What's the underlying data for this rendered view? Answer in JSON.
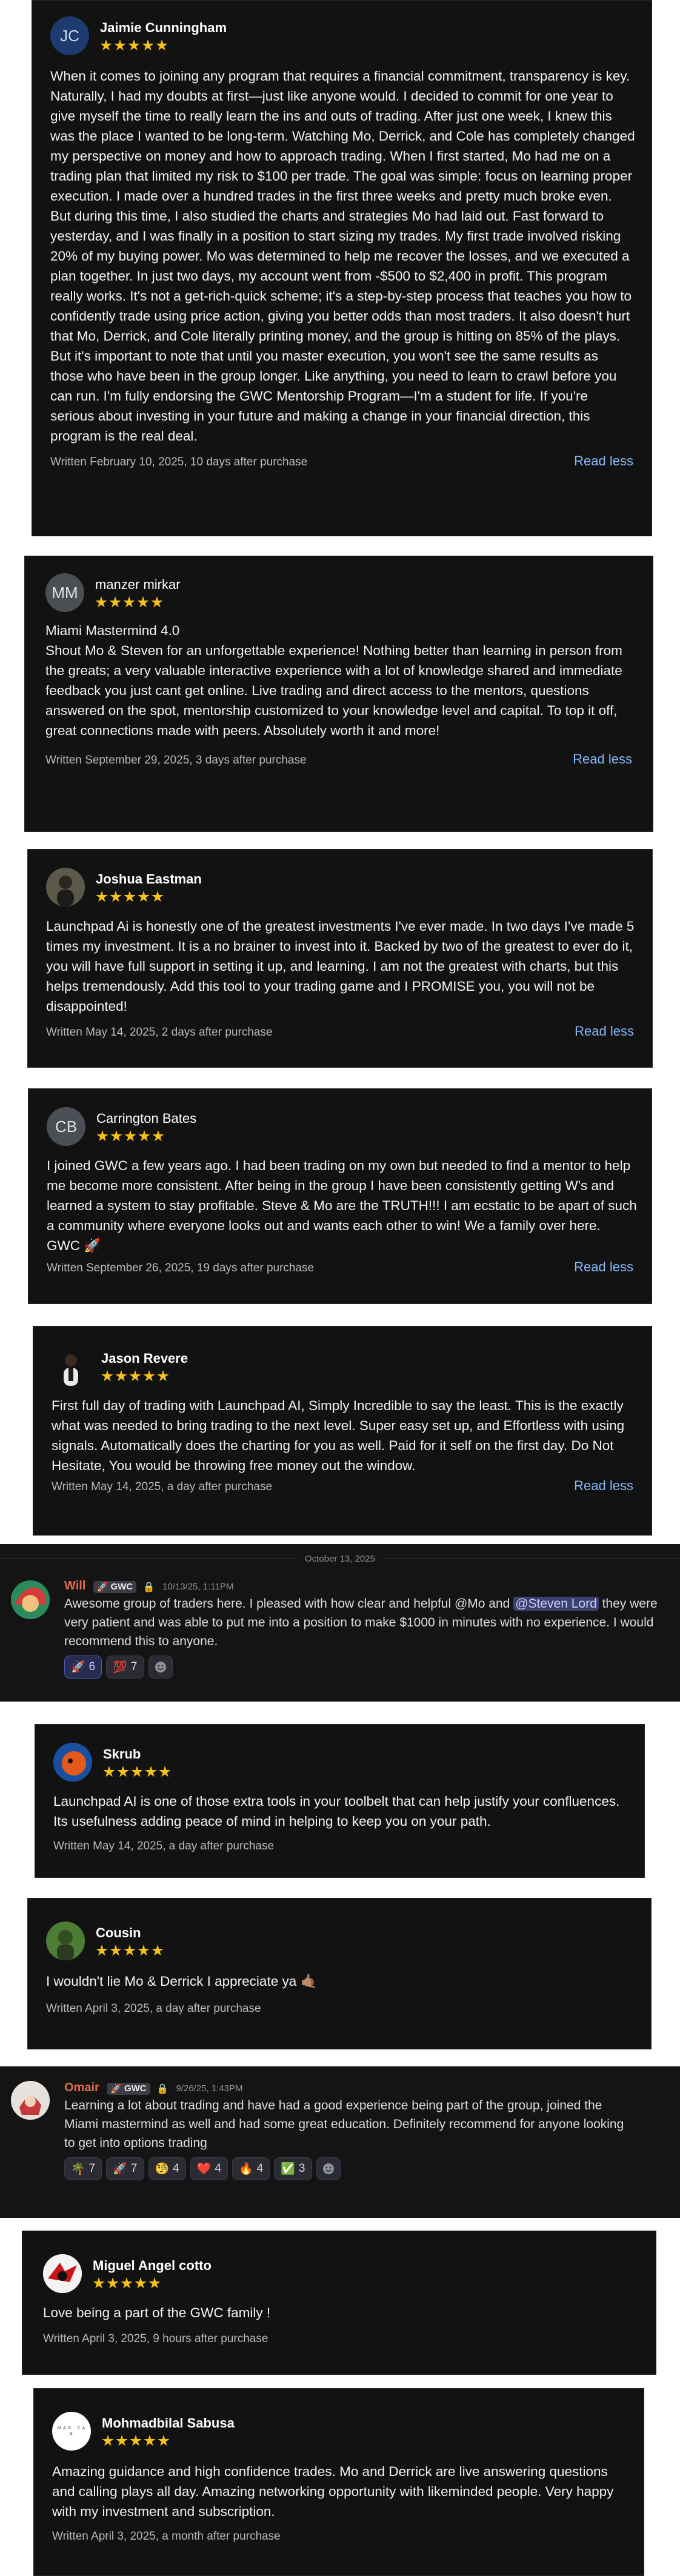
{
  "reviews": [
    {
      "name": "Jaimie Cunningham",
      "initials": "JC",
      "text": "When it comes to joining any program that requires a financial commitment, transparency is key. Naturally, I had my doubts at first—just like anyone would. I decided to commit for one year to give myself the time to really learn the ins and outs of trading. After just one week, I knew this was the place I wanted to be long-term. Watching Mo, Derrick, and Cole has completely changed my perspective on money and how to approach trading. When I first started, Mo had me on a trading plan that limited my risk to $100 per trade. The goal was simple: focus on learning proper execution. I made over a hundred trades in the first three weeks and pretty much broke even. But during this time, I also studied the charts and strategies Mo had laid out. Fast forward to yesterday, and I was finally in a position to start sizing my trades. My first trade involved risking 20% of my buying power. Mo was determined to help me recover the losses, and we executed a plan together. In just two days, my account went from -$500 to $2,400 in profit. This program really works. It's not a get-rich-quick scheme; it's a step-by-step process that teaches you how to confidently trade using price action, giving you better odds than most traders.  It also doesn't hurt that Mo, Derrick, and Cole literally printing money, and the group is hitting on 85% of the plays. But it's important to note that until you master execution, you won't see the same results as those who have been in the group longer. Like anything, you need to learn to crawl before you can run. I'm fully endorsing the GWC Mentorship Program—I'm a student for life. If you're serious about investing in your future and making a change in your financial direction, this program is the real deal.",
      "written": "Written February 10, 2025, 10 days after purchase",
      "read_less": "Read less"
    },
    {
      "name": "manzer mirkar",
      "initials": "MM",
      "subtitle": "Miami Mastermind 4.0",
      "text": "Shout Mo & Steven for an unforgettable experience! Nothing better than learning in person from the greats; a very valuable interactive experience with a lot of knowledge shared and immediate feedback you just cant get online. Live trading and direct access to the mentors, questions answered on the spot, mentorship customized to your knowledge level and capital. To top it off, great connections made with peers. Absolutely worth it and more!",
      "written": "Written September 29, 2025, 3 days after purchase",
      "read_less": "Read less"
    },
    {
      "name": "Joshua Eastman",
      "text": "Launchpad Ai is honestly one of the greatest investments I've ever made. In two days I've made 5 times my investment. It is a no brainer to invest into it. Backed by two of the greatest to ever do it, you will have full support in setting it up, and learning. I am not the greatest with charts, but this helps tremendously. Add this tool to your trading game and I PROMISE you, you will not be disappointed!",
      "written": "Written May 14, 2025, 2 days after purchase",
      "read_less": "Read less"
    },
    {
      "name": "Carrington Bates",
      "initials": "CB",
      "text": "I joined GWC a few years ago. I had been trading on my own but needed to find a mentor to help me become more consistent. After being in the group I have been consistently getting W's and learned a system to stay profitable. Steve & Mo are the TRUTH!!! I am ecstatic to be apart of such a community where everyone looks out and wants each other to win! We a family over here. GWC 🚀",
      "written": "Written September 26, 2025, 19 days after purchase",
      "read_less": "Read less"
    },
    {
      "name": "Jason Revere",
      "text": "First full day of trading with Launchpad AI, Simply Incredible to say the least. This is the exactly what was needed to bring trading to the next level. Super easy set up, and Effortless with using signals. Automatically does the charting for you as well. Paid for it self on the first day. Do Not Hesitate, You would be throwing free money out the window.",
      "written": "Written May 14, 2025, a day after purchase",
      "read_less": "Read less"
    }
  ],
  "discord1": {
    "date_divider": "October 13, 2025",
    "name": "Will",
    "tag": "GWC",
    "time": "10/13/25, 1:11PM",
    "text_before": "Awesome group of traders here. I pleased with how clear and helpful @Mo and ",
    "mention": "@Steven Lord",
    "text_after": " they were very patient and was able to put me into a position to make $1000 in minutes with no experience. I would recommend this to anyone.",
    "reactions": [
      {
        "emoji": "🚀",
        "count": "6",
        "highlight": true
      },
      {
        "emoji": "💯",
        "count": "7",
        "highlight": false
      }
    ]
  },
  "reviews2": [
    {
      "name": "Skrub",
      "text": "Launchpad AI is one of those extra tools in your toolbelt that can help justify your confluences. Its usefulness adding peace of mind in helping to keep you on your path.",
      "written": "Written May 14, 2025, a day after purchase"
    },
    {
      "name": "Cousin",
      "text": "I wouldn't lie Mo & Derrick I appreciate ya 🤙🏽",
      "written": "Written April 3, 2025, a day after purchase"
    }
  ],
  "discord2": {
    "name": "Omair",
    "tag": "GWC",
    "time": "9/26/25, 1:43PM",
    "text": "Learning a lot about trading and have had a good experience being part of the group, joined the Miami mastermind as well and had some great education. Definitely recommend for anyone looking to get into options trading",
    "reactions": [
      {
        "emoji": "🌴",
        "count": "7",
        "highlight": false
      },
      {
        "emoji": "🚀",
        "count": "7",
        "highlight": false
      },
      {
        "emoji": "🧐",
        "count": "4",
        "highlight": false
      },
      {
        "emoji": "❤️",
        "count": "4",
        "highlight": false
      },
      {
        "emoji": "🔥",
        "count": "4",
        "highlight": false
      },
      {
        "emoji": "✅",
        "count": "3",
        "highlight": false
      }
    ]
  },
  "reviews3": [
    {
      "name": "Miguel Angel cotto",
      "text": "Love being a part of the GWC family !",
      "written": "Written April 3, 2025, 9 hours after purchase"
    },
    {
      "name": "Mohmadbilal Sabusa",
      "avatar_text": "M A B · S A B",
      "text": "Amazing guidance and high confidence trades. Mo and Derrick are live answering questions and calling plays all day. Amazing networking opportunity with likeminded people. Very happy with my investment and subscription.",
      "written": "Written April 3, 2025, a month after purchase"
    }
  ],
  "colors": {
    "card_bg": "#121212",
    "star": "#f6c21a",
    "link": "#86b8f8",
    "mention_bg": "#3c4270"
  }
}
